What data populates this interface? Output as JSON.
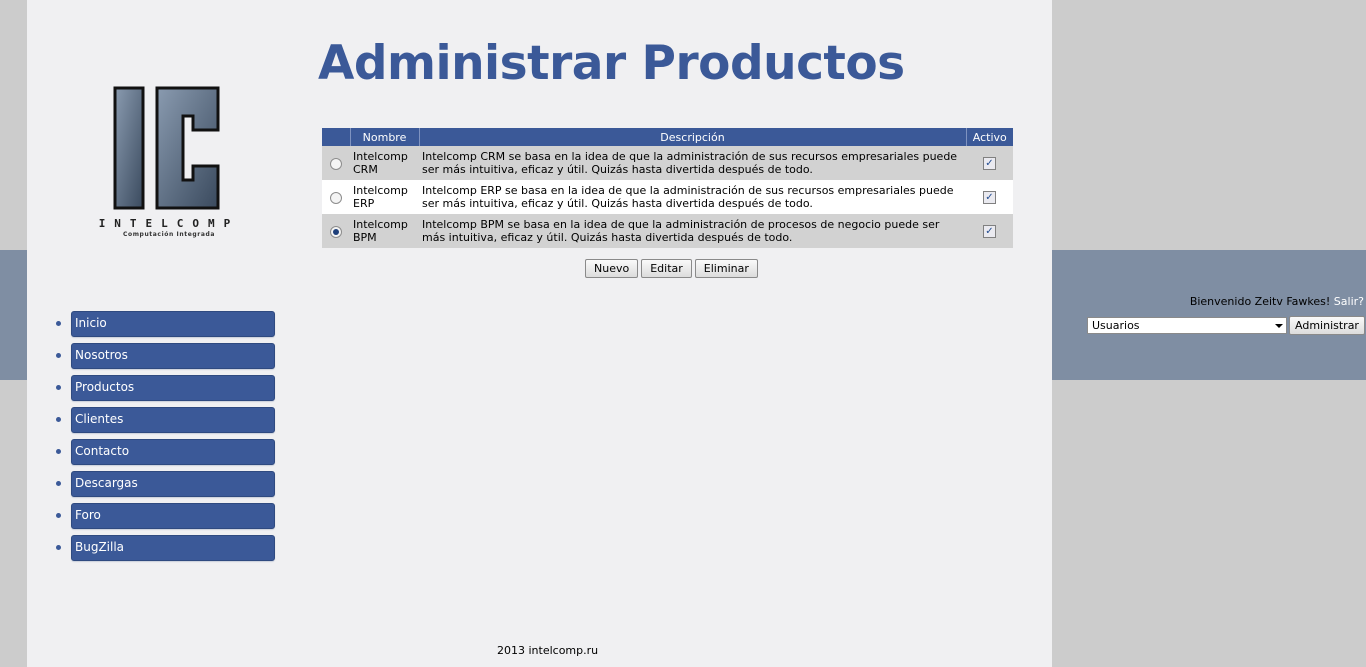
{
  "header": {
    "title": "Administrar Productos"
  },
  "logo": {
    "wordmark": "INTELCOMP",
    "tagline": "Computación Integrada",
    "monogram": "IC"
  },
  "table": {
    "headers": [
      "",
      "Nombre",
      "Descripción",
      "Activo"
    ],
    "rows": [
      {
        "name": "Intelcomp CRM",
        "description": "Intelcomp CRM se basa en la idea de que la administración de sus recursos empresariales puede ser más intuitiva, eficaz y útil. Quizás hasta divertida después de todo.",
        "active": true,
        "selected": false
      },
      {
        "name": "Intelcomp ERP",
        "description": "Intelcomp ERP se basa en la idea de que la administración de sus recursos empresariales puede ser más intuitiva, eficaz y útil. Quizás hasta divertida después de todo.",
        "active": true,
        "selected": false
      },
      {
        "name": "Intelcomp BPM",
        "description": "Intelcomp BPM se basa en la idea de que la administración de procesos de negocio puede ser más intuitiva, eficaz y útil. Quizás hasta divertida después de todo.",
        "active": true,
        "selected": true
      }
    ]
  },
  "actions": {
    "new_label": "Nuevo",
    "edit_label": "Editar",
    "delete_label": "Eliminar"
  },
  "menu": {
    "items": [
      "Inicio",
      "Nosotros",
      "Productos",
      "Clientes",
      "Contacto",
      "Descargas",
      "Foro",
      "BugZilla"
    ]
  },
  "user": {
    "welcome": "Bienvenido Zeitv Fawkes!",
    "logout": "Salir?",
    "admin_select_value": "Usuarios",
    "admin_button": "Administrar"
  },
  "footer": {
    "text": "2013 intelcomp.ru"
  },
  "colors": {
    "brand": "#3b5998",
    "band": "#7f8ea3",
    "background": "#cccccc",
    "page": "#f0f0f2"
  },
  "icons": {
    "check": "check-icon",
    "dropdown": "chevron-down-icon"
  }
}
